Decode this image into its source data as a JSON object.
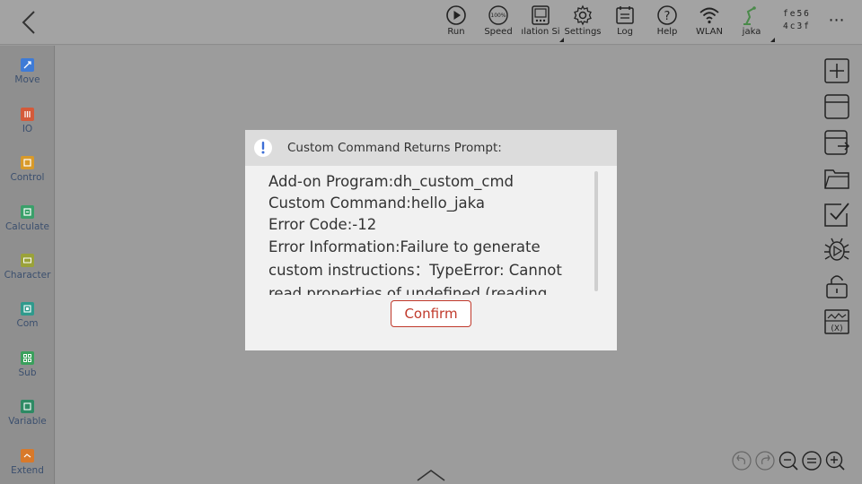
{
  "toolbar": {
    "items": [
      {
        "label": "Run",
        "icon": "play-icon"
      },
      {
        "label": "Speed",
        "icon": "speed-gauge-icon"
      },
      {
        "label": "ılation Si",
        "icon": "simulation-icon"
      },
      {
        "label": "Settings",
        "icon": "gear-icon"
      },
      {
        "label": "Log",
        "icon": "log-icon"
      },
      {
        "label": "Help",
        "icon": "help-icon"
      },
      {
        "label": "WLAN",
        "icon": "wifi-icon"
      },
      {
        "label": "jaka",
        "icon": "robot-arm-icon"
      }
    ],
    "id_line1": "fe56",
    "id_line2": "4c3f",
    "more": "⋯"
  },
  "sidebar": {
    "items": [
      {
        "label": "Move",
        "color": "#3e7bd6"
      },
      {
        "label": "IO",
        "color": "#d45a3a"
      },
      {
        "label": "Control",
        "color": "#d89a2a"
      },
      {
        "label": "Calculate",
        "color": "#3aa06a"
      },
      {
        "label": "Character",
        "color": "#9aa23a"
      },
      {
        "label": "Com",
        "color": "#2f9a8c"
      },
      {
        "label": "Sub",
        "color": "#3aa05c"
      },
      {
        "label": "Variable",
        "color": "#2e8a64"
      },
      {
        "label": "Extend",
        "color": "#d8792a"
      }
    ]
  },
  "dialog": {
    "title": "Custom Command Returns Prompt:",
    "lines": [
      "Add-on Program:dh_custom_cmd",
      "Custom Command:hello_jaka",
      "Error Code:-12",
      "Error Information:Failure to generate custom instructions：TypeError: Cannot read properties of undefined (reading 'type')"
    ],
    "confirm_label": "Confirm"
  },
  "colors": {
    "accent_red": "#c0392b",
    "dialog_bg": "#f1f1f1",
    "dialog_header": "#dcdcdc",
    "overlay": "#9c9c9c"
  }
}
